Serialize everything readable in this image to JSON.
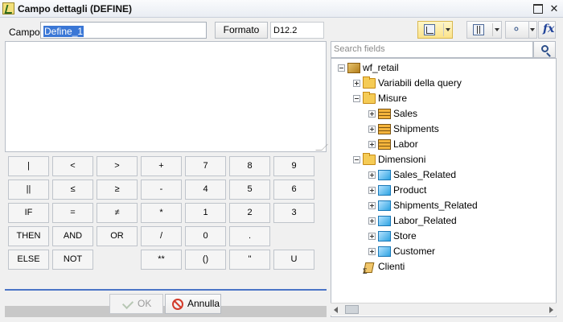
{
  "window": {
    "title": "Campo dettagli (DEFINE)"
  },
  "field": {
    "label": "Campo",
    "value": "Define_1",
    "format_button": "Formato",
    "format_value": "D12.2"
  },
  "keypad": [
    [
      "|",
      "<",
      ">",
      "+",
      "7",
      "8",
      "9"
    ],
    [
      "||",
      "≤",
      "≥",
      "-",
      "4",
      "5",
      "6"
    ],
    [
      "IF",
      "=",
      "≠",
      "*",
      "1",
      "2",
      "3"
    ],
    [
      "THEN",
      "AND",
      "OR",
      "/",
      "0",
      ".",
      ""
    ],
    [
      "ELSE",
      "NOT",
      "",
      "**",
      "()",
      "\"",
      "U"
    ]
  ],
  "buttons": {
    "ok": "OK",
    "cancel": "Annulla"
  },
  "search": {
    "placeholder": "Search fields"
  },
  "tree": [
    {
      "label": "wf_retail",
      "icon": "cube",
      "depth": 0,
      "expander": "minus"
    },
    {
      "label": "Variabili della query",
      "icon": "folder",
      "depth": 1,
      "expander": "plus"
    },
    {
      "label": "Misure",
      "icon": "folder",
      "depth": 1,
      "expander": "minus"
    },
    {
      "label": "Sales",
      "icon": "measure",
      "depth": 2,
      "expander": "plus"
    },
    {
      "label": "Shipments",
      "icon": "measure",
      "depth": 2,
      "expander": "plus"
    },
    {
      "label": "Labor",
      "icon": "measure",
      "depth": 2,
      "expander": "plus"
    },
    {
      "label": "Dimensioni",
      "icon": "folder",
      "depth": 1,
      "expander": "minus"
    },
    {
      "label": "Sales_Related",
      "icon": "dim",
      "depth": 2,
      "expander": "plus"
    },
    {
      "label": "Product",
      "icon": "dim",
      "depth": 2,
      "expander": "plus"
    },
    {
      "label": "Shipments_Related",
      "icon": "dim",
      "depth": 2,
      "expander": "plus"
    },
    {
      "label": "Labor_Related",
      "icon": "dim",
      "depth": 2,
      "expander": "plus"
    },
    {
      "label": "Store",
      "icon": "dim",
      "depth": 2,
      "expander": "plus"
    },
    {
      "label": "Customer",
      "icon": "dim",
      "depth": 2,
      "expander": "plus"
    },
    {
      "label": "Clienti",
      "icon": "clienti",
      "depth": 1,
      "expander": "none"
    }
  ]
}
